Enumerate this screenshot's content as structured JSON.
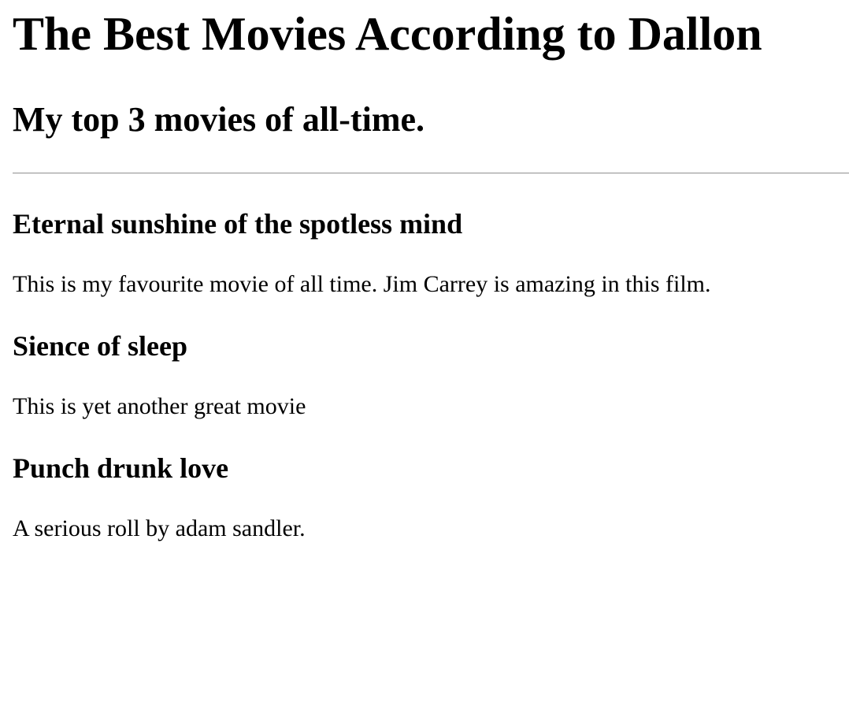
{
  "page": {
    "title": "The Best Movies According to Dallon",
    "subtitle": "My top 3 movies of all-time."
  },
  "movies": [
    {
      "title": "Eternal sunshine of the spotless mind",
      "description": "This is my favourite movie of all time. Jim Carrey is amazing in this film."
    },
    {
      "title": "Sience of sleep",
      "description": "This is yet another great movie"
    },
    {
      "title": "Punch drunk love",
      "description": "A serious roll by adam sandler."
    }
  ]
}
